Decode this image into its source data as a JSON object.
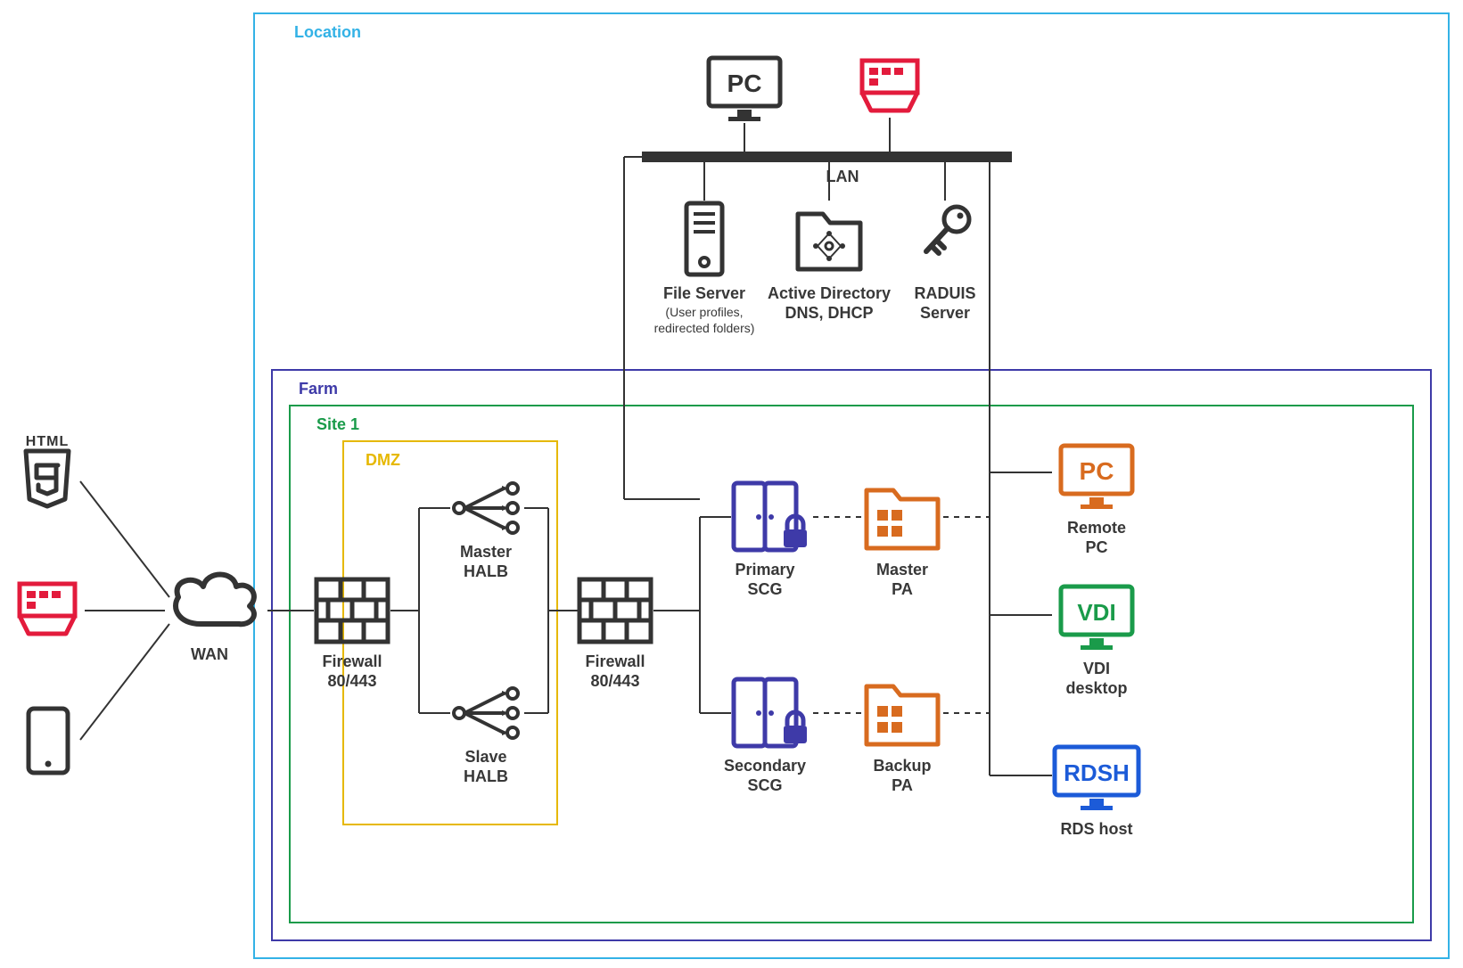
{
  "containers": {
    "location": "Location",
    "farm": "Farm",
    "site": "Site 1",
    "dmz": "DMZ"
  },
  "wan": {
    "label": "WAN"
  },
  "lan": {
    "label": "LAN"
  },
  "firewall": {
    "label1": "Firewall",
    "label2": "80/443"
  },
  "halb": {
    "master": {
      "l1": "Master",
      "l2": "HALB"
    },
    "slave": {
      "l1": "Slave",
      "l2": "HALB"
    }
  },
  "scg": {
    "primary": {
      "l1": "Primary",
      "l2": "SCG"
    },
    "secondary": {
      "l1": "Secondary",
      "l2": "SCG"
    }
  },
  "pa": {
    "master": {
      "l1": "Master",
      "l2": "PA"
    },
    "backup": {
      "l1": "Backup",
      "l2": "PA"
    }
  },
  "resources": {
    "remotepc": {
      "badge": "PC",
      "l1": "Remote",
      "l2": "PC"
    },
    "vdi": {
      "badge": "VDI",
      "l1": "VDI",
      "l2": "desktop"
    },
    "rdsh": {
      "badge": "RDSH",
      "l1": "RDS host"
    }
  },
  "lan_nodes": {
    "pc_badge": "PC",
    "fileserver": {
      "l1": "File Server",
      "l2": "(User profiles,",
      "l3": "redirected folders)"
    },
    "ad": {
      "l1": "Active Directory",
      "l2": "DNS, DHCP"
    },
    "radius": {
      "l1": "RADUIS",
      "l2": "Server"
    }
  },
  "colors": {
    "location": "#33b2e6",
    "farm": "#3e3aa8",
    "site": "#1a9b4a",
    "dmz": "#e6b800",
    "outline": "#333333",
    "violet": "#3e3aa8",
    "red": "#e31b3c",
    "orange": "#d86b1f",
    "green": "#1a9b4a",
    "blue": "#1c5bd8"
  }
}
